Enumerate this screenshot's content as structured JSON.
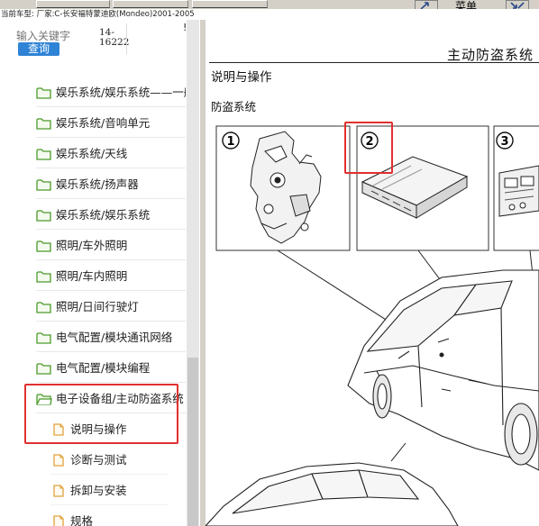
{
  "toolbar": {
    "menu_label": "菜单"
  },
  "status_bar": {
    "text": "当前车型:   厂家:C-长安福特蒙迪欧(Mondeo)2001-2005"
  },
  "search": {
    "placeholder": "输入关键字",
    "button_label": "查询",
    "code": "14-16222",
    "mark": "!"
  },
  "tree": {
    "items": [
      {
        "label": "娱乐系统/娱乐系统——一般",
        "icon": "folder-icon"
      },
      {
        "label": "娱乐系统/音响单元",
        "icon": "folder-icon"
      },
      {
        "label": "娱乐系统/天线",
        "icon": "folder-icon"
      },
      {
        "label": "娱乐系统/扬声器",
        "icon": "folder-icon"
      },
      {
        "label": "娱乐系统/娱乐系统",
        "icon": "folder-icon"
      },
      {
        "label": "照明/车外照明",
        "icon": "folder-icon"
      },
      {
        "label": "照明/车内照明",
        "icon": "folder-icon"
      },
      {
        "label": "照明/日间行驶灯",
        "icon": "folder-icon"
      },
      {
        "label": "电气配置/模块通讯网络",
        "icon": "folder-icon"
      },
      {
        "label": "电气配置/模块编程",
        "icon": "folder-icon"
      },
      {
        "label": "电子设备组/主动防盗系统",
        "icon": "folder-open-icon"
      },
      {
        "label": "说明与操作",
        "icon": "document-icon"
      },
      {
        "label": "诊断与测试",
        "icon": "document-icon"
      },
      {
        "label": "拆卸与安装",
        "icon": "document-icon"
      },
      {
        "label": "规格",
        "icon": "document-icon"
      }
    ]
  },
  "document": {
    "title": "主动防盗系统",
    "heading": "说明与操作",
    "subheading": "防盗系统",
    "callouts": [
      "1",
      "2",
      "3"
    ]
  },
  "colors": {
    "highlight": "#e03030",
    "button": "#2f83d6",
    "folder": "#4a9a2a",
    "document": "#e0a23a"
  }
}
